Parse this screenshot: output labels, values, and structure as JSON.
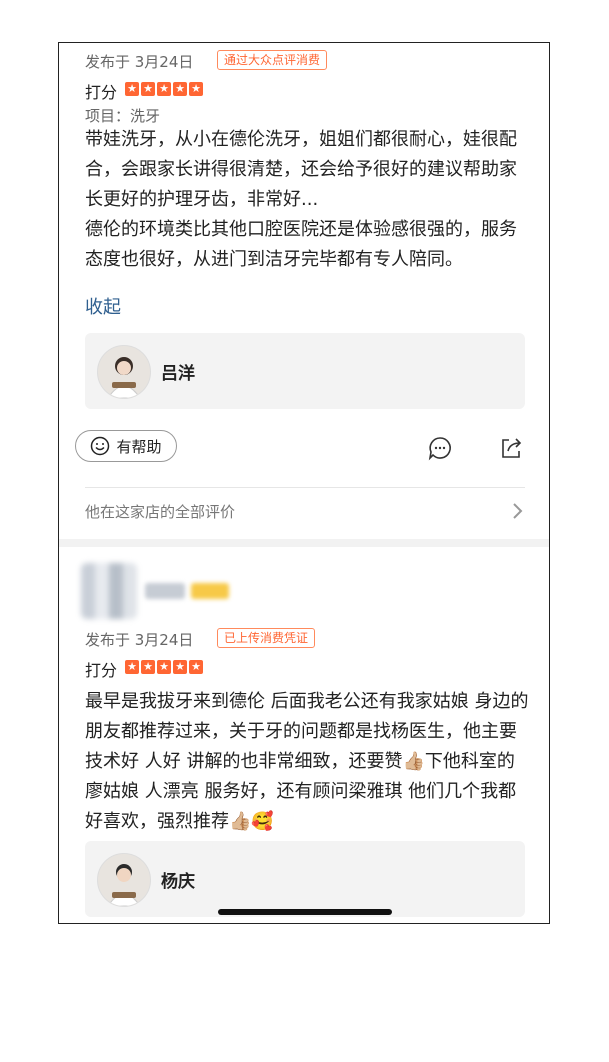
{
  "reviews": [
    {
      "date": "发布于 3月24日",
      "badge": "通过大众点评消费",
      "score_label": "打分",
      "stars": 5,
      "item_line": "项目：洗牙",
      "text_p1": "带娃洗牙，从小在德伦洗牙，姐姐们都很耐心，娃很配合，会跟家长讲得很清楚，还会给予很好的建议帮助家长更好的护理牙齿，非常好...",
      "text_p2": "德伦的环境类比其他口腔医院还是体验感很强的，服务态度也很好，从进门到洁牙完毕都有专人陪同。",
      "collapse_label": "收起",
      "doctor_name": "吕洋",
      "helpful_label": "有帮助",
      "all_reviews_label": "他在这家店的全部评价"
    },
    {
      "date": "发布于 3月24日",
      "badge": "已上传消费凭证",
      "score_label": "打分",
      "stars": 5,
      "text": "最早是我拔牙来到德伦 后面我老公还有我家姑娘 身边的朋友都推荐过来，关于牙的问题都是找杨医生，他主要技术好 人好 讲解的也非常细致，还要赞👍🏼下他科室的廖姑娘 人漂亮 服务好，还有顾问梁雅琪 他们几个我都好喜欢，强烈推荐👍🏼🥰",
      "doctor_name": "杨庆"
    }
  ],
  "colors": {
    "accent": "#ff6633",
    "link": "#2f5f8f"
  }
}
